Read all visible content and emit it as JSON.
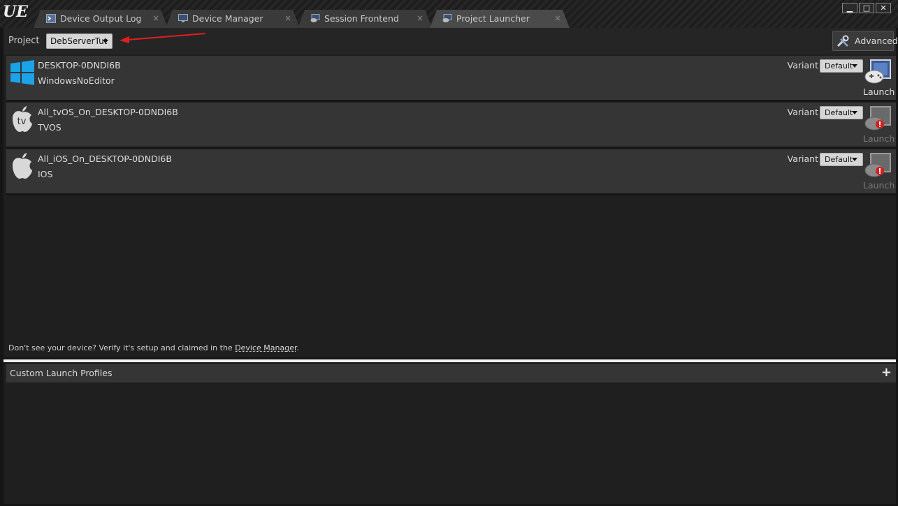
{
  "app": {
    "logo": "UE"
  },
  "tabs": [
    {
      "label": "Device Output Log",
      "icon": "terminal-icon",
      "active": false
    },
    {
      "label": "Device Manager",
      "icon": "monitor-icon",
      "active": false
    },
    {
      "label": "Session Frontend",
      "icon": "gamepad-monitor-icon",
      "active": false
    },
    {
      "label": "Project Launcher",
      "icon": "gamepad-monitor-icon",
      "active": true
    }
  ],
  "tab_close_glyph": "×",
  "window_controls": {
    "minimize": "▁",
    "maximize": "□",
    "close": "✕"
  },
  "toolbar": {
    "project_label": "Project",
    "project_value": "DebServerTut",
    "advanced_label": "Advanced"
  },
  "devices": [
    {
      "name": "DESKTOP-0DNDI6B",
      "platform": "WindowsNoEditor",
      "icon": "windows-icon",
      "variant_label": "Variant",
      "variant_value": "Default",
      "launch_label": "Launch",
      "launch_enabled": true
    },
    {
      "name": "All_tvOS_On_DESKTOP-0DNDI6B",
      "platform": "TVOS",
      "icon": "apple-tv-icon",
      "variant_label": "Variant",
      "variant_value": "Default",
      "launch_label": "Launch",
      "launch_enabled": false
    },
    {
      "name": "All_iOS_On_DESKTOP-0DNDI6B",
      "platform": "IOS",
      "icon": "apple-icon",
      "variant_label": "Variant",
      "variant_value": "Default",
      "launch_label": "Launch",
      "launch_enabled": false
    }
  ],
  "hint": {
    "text": "Don't see your device? Verify it's setup and claimed in the ",
    "link": "Device Manager",
    "suffix": "."
  },
  "custom_profiles": {
    "title": "Custom Launch Profiles",
    "add_glyph": "+"
  },
  "colors": {
    "windows_blue": "#1aa3e8",
    "warning_red": "#d42020",
    "annotation_arrow": "#e02020"
  }
}
